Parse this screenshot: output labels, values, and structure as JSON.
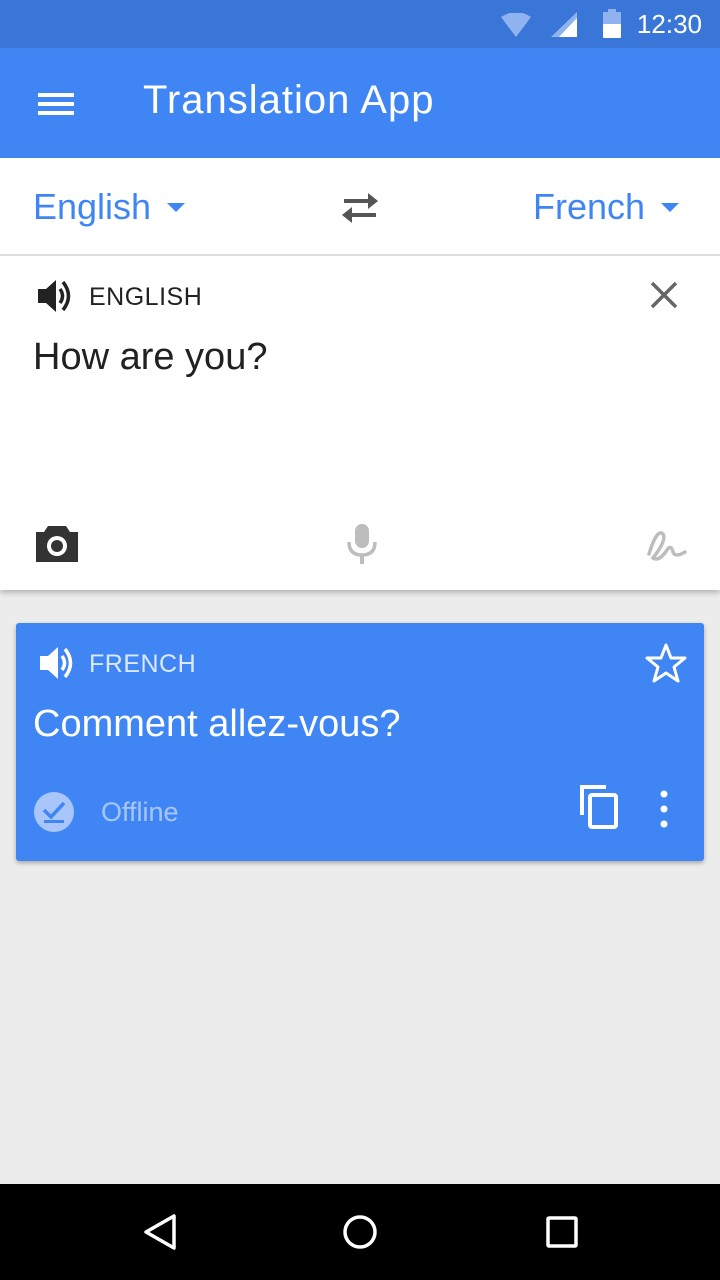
{
  "status_bar": {
    "time": "12:30",
    "icons": [
      "wifi-icon",
      "signal-icon",
      "battery-icon"
    ]
  },
  "app_bar": {
    "title": "Translation App",
    "menu_icon": "menu-icon"
  },
  "languages": {
    "source": "English",
    "target": "French",
    "swap_icon": "swap-icon"
  },
  "input": {
    "lang_label": "ENGLISH",
    "text": "How are you?",
    "icons": [
      "speaker-icon",
      "close-icon",
      "camera-icon",
      "microphone-icon",
      "handwriting-icon"
    ]
  },
  "result": {
    "lang_label": "FRENCH",
    "text": "Comment allez-vous?",
    "status": "Offline",
    "icons": [
      "speaker-icon",
      "star-icon",
      "offline-check-icon",
      "copy-icon",
      "more-vert-icon"
    ]
  },
  "nav_bar": {
    "icons": [
      "back-icon",
      "home-icon",
      "recents-icon"
    ]
  },
  "colors": {
    "primary": "#3f86f4",
    "status_bar": "#3a76d8",
    "background": "#ececec"
  }
}
